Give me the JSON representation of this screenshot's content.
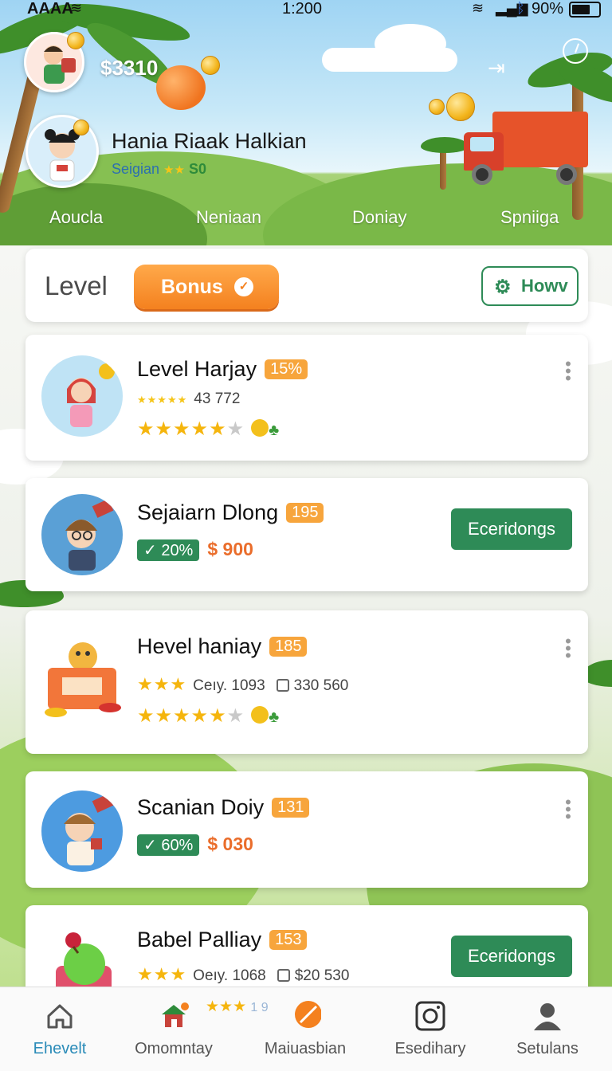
{
  "status_bar": {
    "carrier": "AAAA",
    "time": "1:200",
    "battery": "90%"
  },
  "header": {
    "balance": "$3310",
    "user_name": "Hania Riaak Halkian",
    "user_sub_label": "Seigian",
    "user_sub_stars": "★★",
    "user_sub_score": "S0",
    "tabs": [
      "Aoucla",
      "Neniaan",
      "Doniay",
      "Spniiga"
    ]
  },
  "level_bar": {
    "title": "Level",
    "bonus_label": "Bonus",
    "how_label": "Howv"
  },
  "cards": [
    {
      "title": "Level Harjay",
      "badge": "15%",
      "meta_stars": "★★★★★",
      "meta_count": "43 772",
      "stars": "★★★★★",
      "half": "★"
    },
    {
      "title": "Sejaiarn Dlong",
      "badge": "195",
      "pct": "✓ 20%",
      "price": "$ 900",
      "button": "Eceridongs"
    },
    {
      "title": "Hevel haniay",
      "badge": "185",
      "stars_small": "★★★",
      "meta_a": "Ceıy. 1093",
      "meta_b": "330 560",
      "stars": "★★★★★",
      "half": "★"
    },
    {
      "title": "Scanian Doiy",
      "badge": "131",
      "pct": "✓ 60%",
      "price": "$ 030"
    },
    {
      "title": "Babel Palliay",
      "badge": "153",
      "stars_small": "★★★",
      "meta_a": "Oeıy. 1068",
      "meta_b": "$20 530",
      "button": "Eceridongs"
    }
  ],
  "bottom_nav": {
    "stars": "★★★",
    "stars_extra": "1 9",
    "items": [
      "Ehevelt",
      "Omomntay",
      "Maiuasbian",
      "Esedihary",
      "Setulans"
    ]
  },
  "colors": {
    "primary_green": "#2e8b57",
    "accent_orange": "#f4811f",
    "active_nav": "#2a8bb8"
  }
}
